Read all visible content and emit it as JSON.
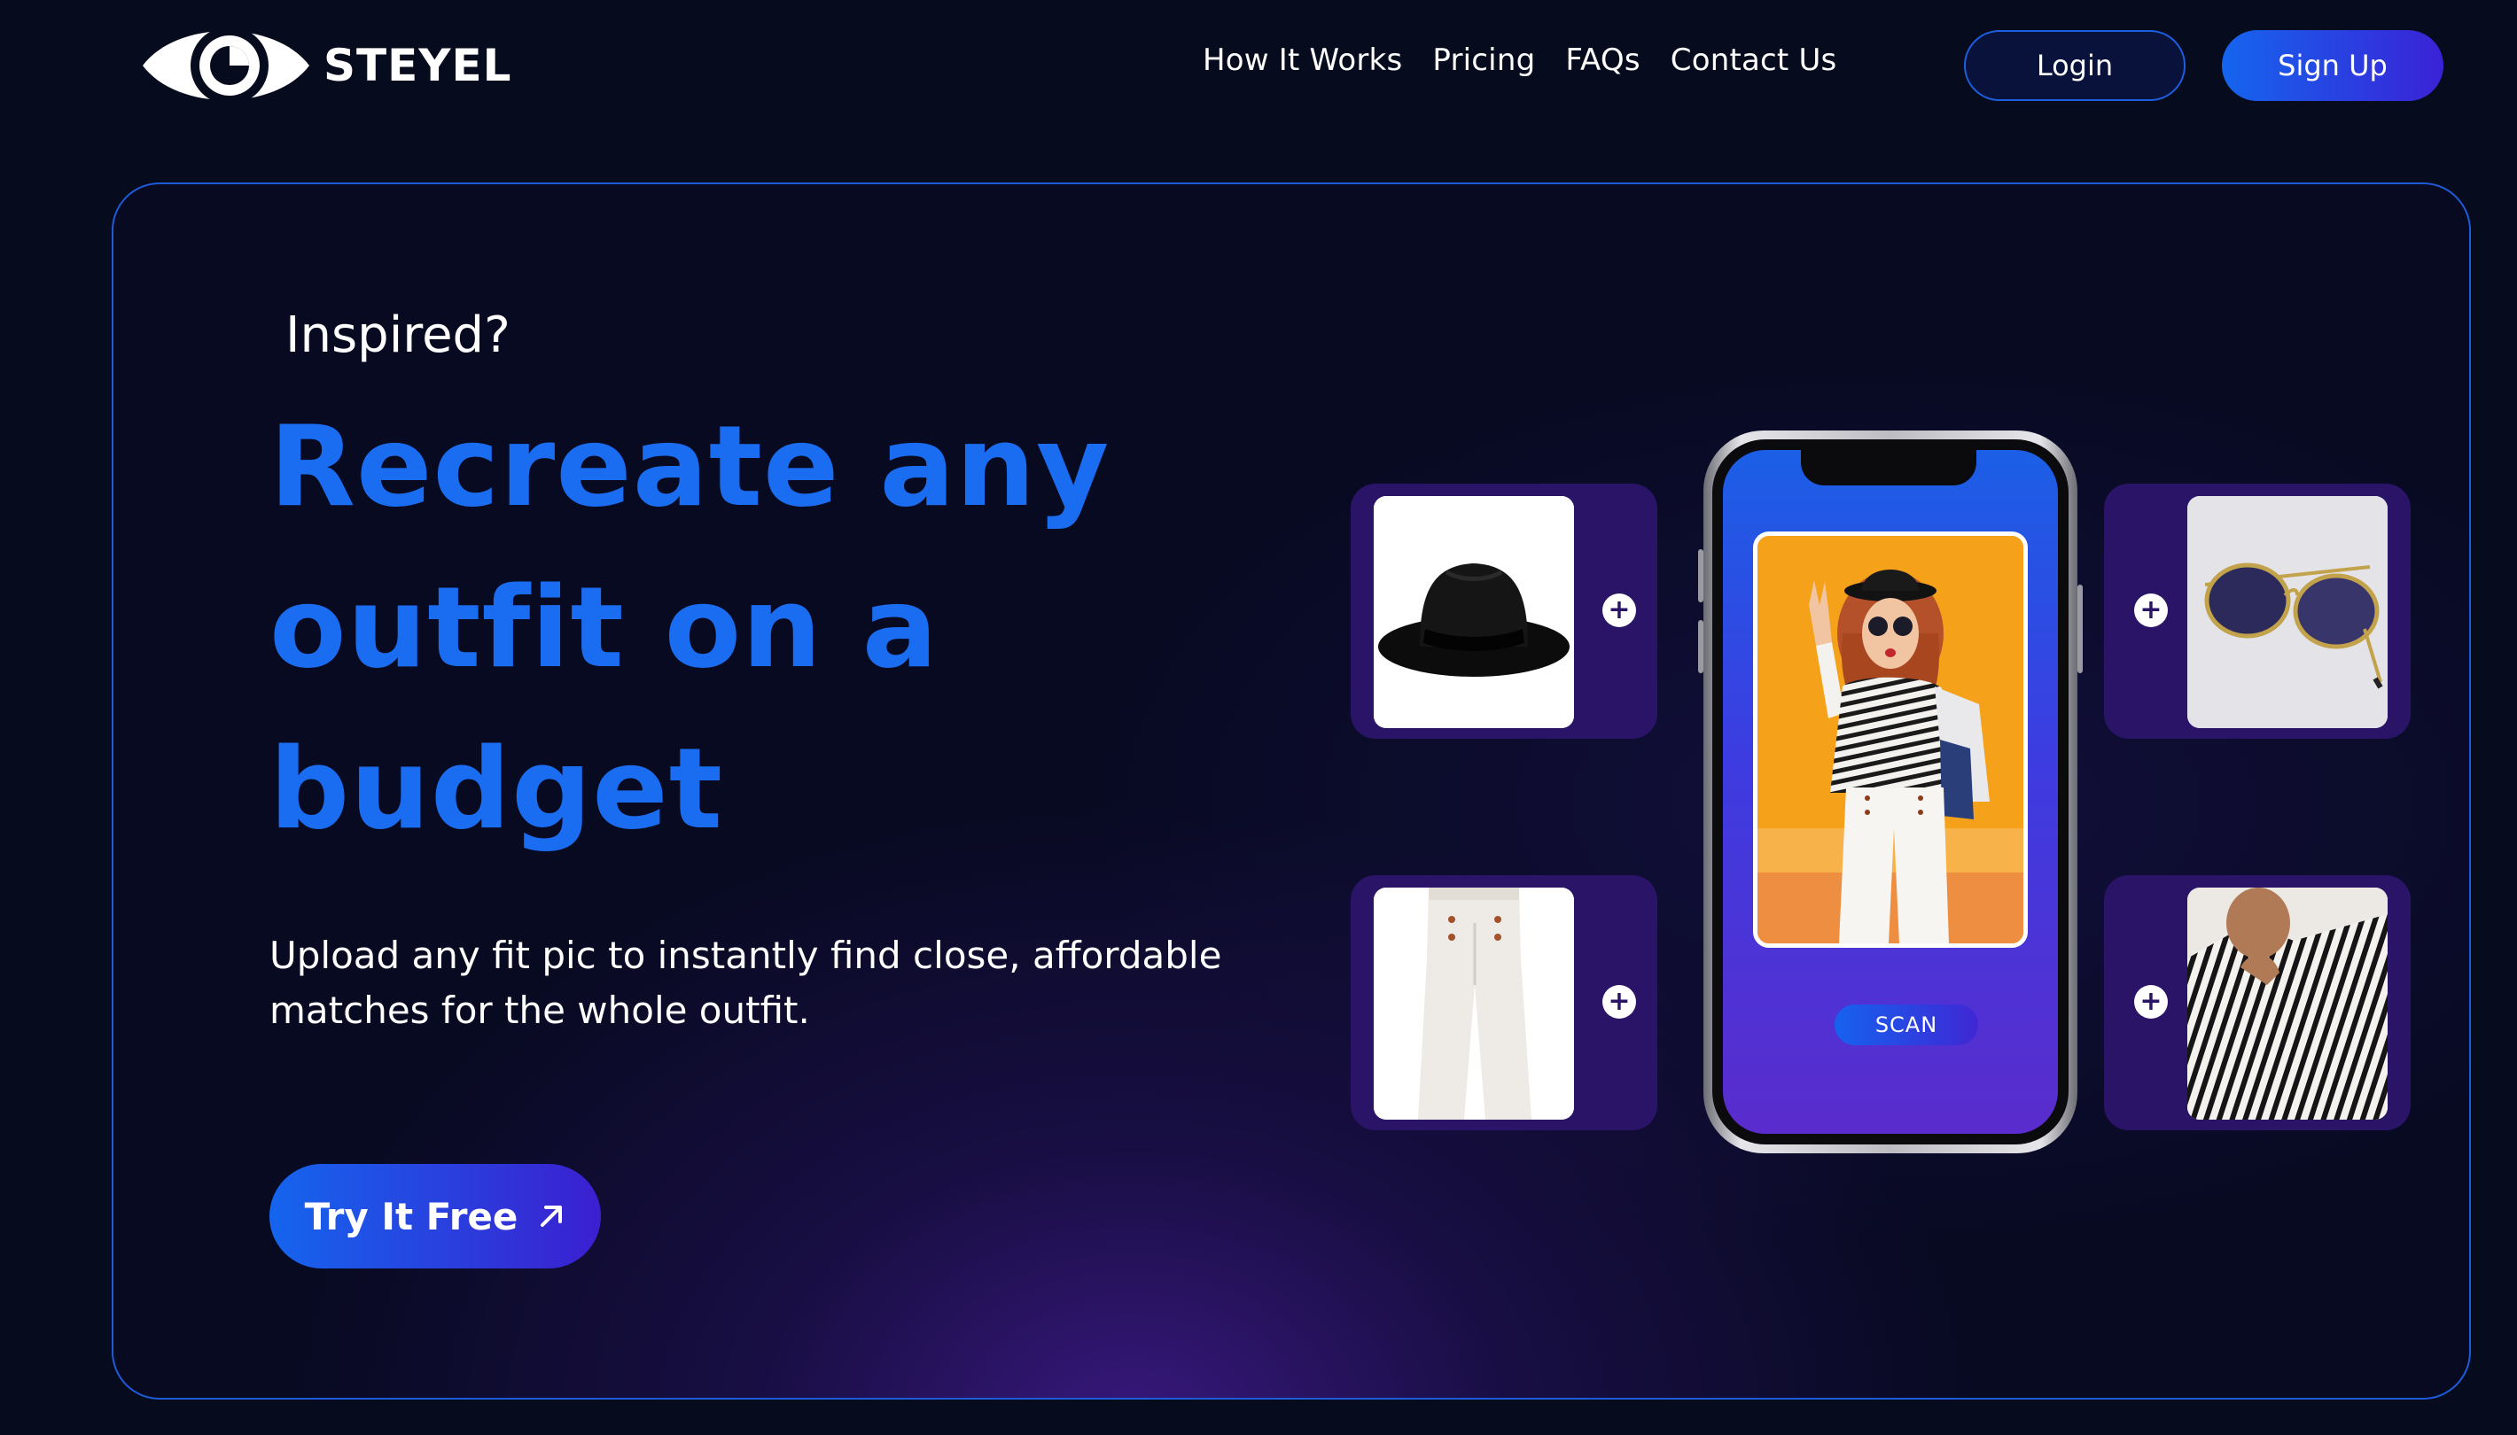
{
  "brand": {
    "name": "STEYEL"
  },
  "nav": {
    "links": [
      "How It Works",
      "Pricing",
      "FAQs",
      "Contact Us"
    ],
    "login_label": "Login",
    "signup_label": "Sign Up"
  },
  "hero": {
    "eyebrow": "Inspired?",
    "headline": "Recreate any outfit on a budget",
    "subtext": "Upload any fit pic to instantly find close, affordable matches for the whole outfit.",
    "cta_label": "Try It Free",
    "cta_icon": "arrow-up-right-icon"
  },
  "phone": {
    "scan_label": "SCAN"
  },
  "products": [
    {
      "name": "hat",
      "icon": "plus-icon"
    },
    {
      "name": "sunglasses",
      "icon": "plus-icon"
    },
    {
      "name": "white-trousers",
      "icon": "plus-icon"
    },
    {
      "name": "striped-shirt",
      "icon": "plus-icon"
    }
  ],
  "colors": {
    "background": "#060b1e",
    "accent_blue": "#1a6df0",
    "accent_purple": "#3b1fd0",
    "tile": "#2a1468",
    "photo_bg": "#f49a12"
  }
}
